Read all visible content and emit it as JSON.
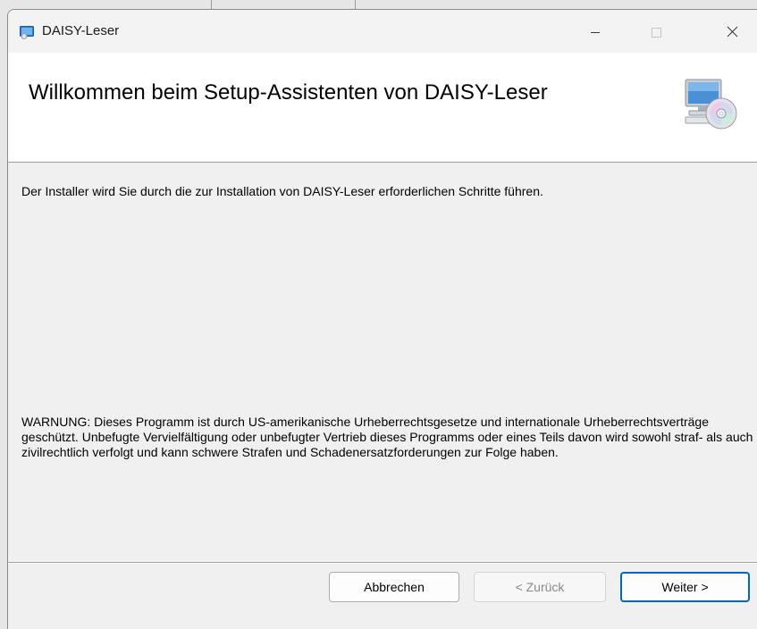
{
  "window": {
    "title": "DAISY-Leser"
  },
  "header": {
    "title": "Willkommen beim Setup-Assistenten von DAISY-Leser"
  },
  "body": {
    "intro": "Der Installer wird Sie durch die zur Installation von DAISY-Leser erforderlichen Schritte führen.",
    "warning": "WARNUNG: Dieses Programm ist durch US-amerikanische Urheberrechtsgesetze und internationale Urheberrechtsverträge geschützt. Unbefugte Vervielfältigung oder unbefugter Vertrieb dieses Programms oder eines Teils davon wird sowohl straf- als auch zivilrechtlich verfolgt und kann schwere Strafen und Schadenersatzforderungen zur Folge haben."
  },
  "buttons": {
    "cancel": "Abbrechen",
    "back": "< Zurück",
    "next": "Weiter >"
  },
  "icons": {
    "app": "installer-app-icon",
    "header": "computer-cd-icon",
    "minimize": "minimize-icon",
    "maximize": "maximize-icon",
    "close": "close-icon"
  },
  "colors": {
    "accent": "#0067c0",
    "header_bg": "#ffffff",
    "dialog_bg": "#f0f0f0"
  },
  "state": {
    "back_enabled": false,
    "maximize_enabled": false
  }
}
